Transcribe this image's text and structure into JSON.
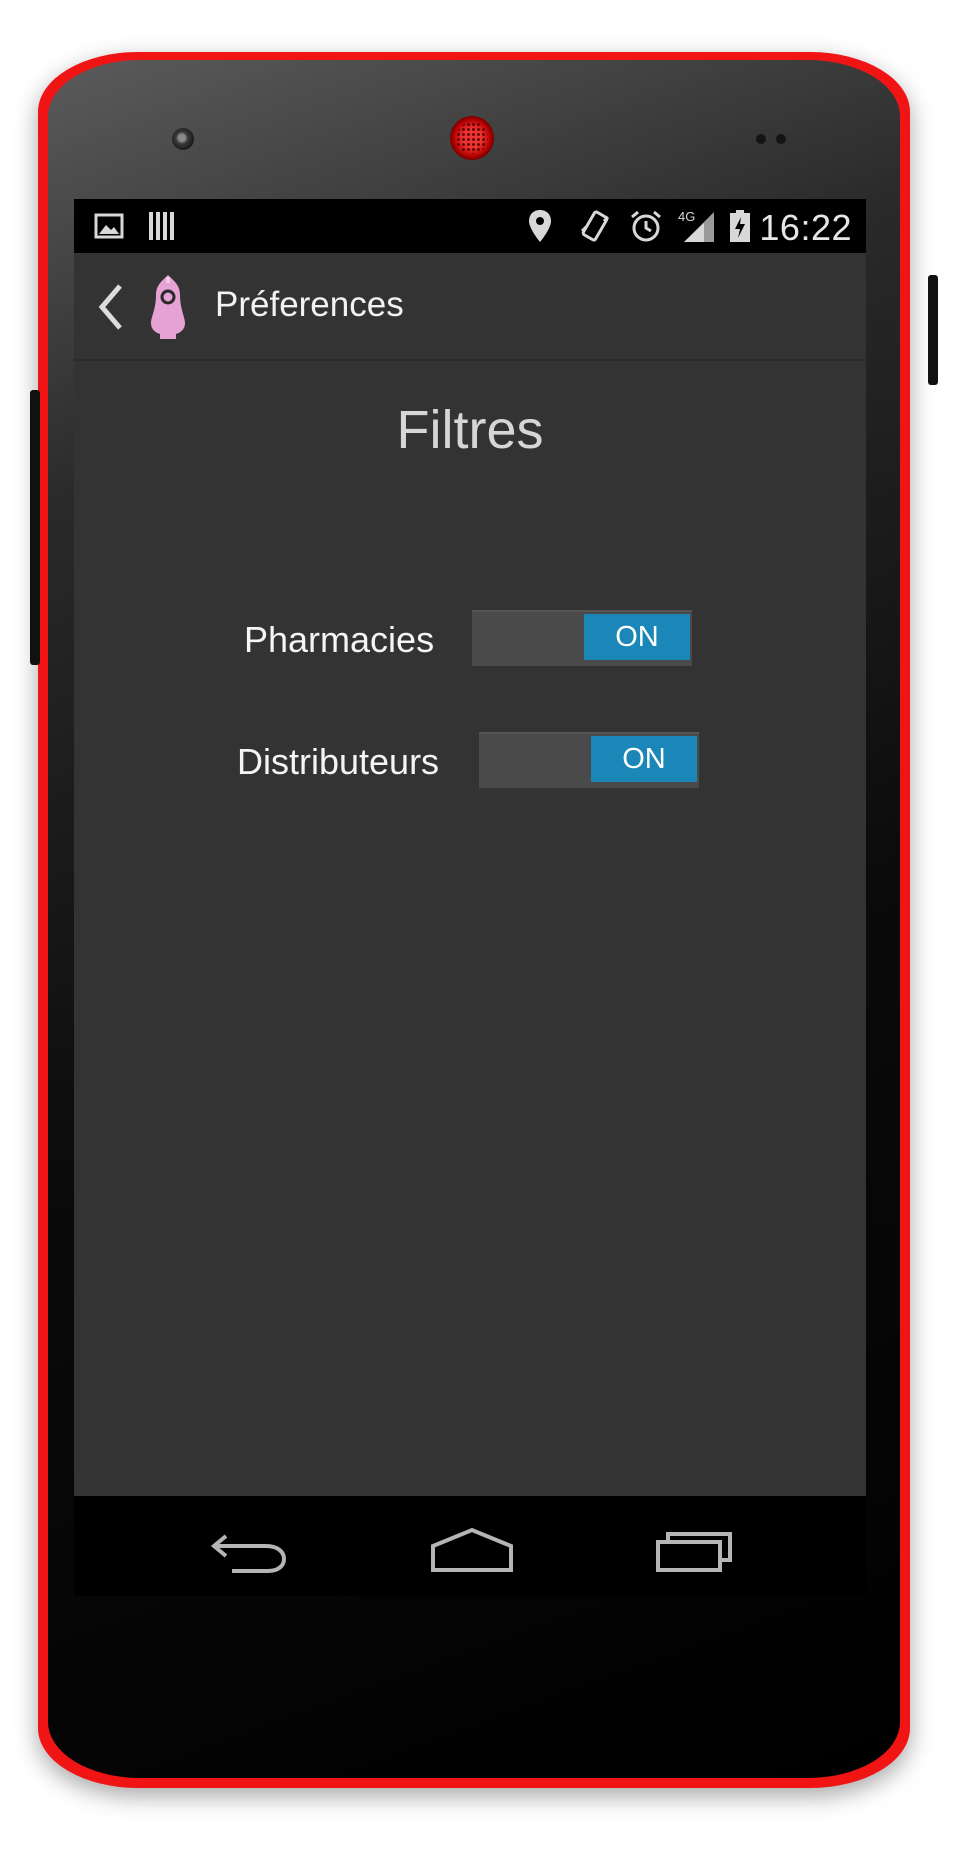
{
  "statusbar": {
    "time": "16:22",
    "network_label": "4G",
    "icons": [
      "gallery-icon",
      "barcode-icon",
      "location-icon",
      "vibrate-icon",
      "alarm-icon",
      "signal-icon",
      "battery-charging-icon"
    ]
  },
  "actionbar": {
    "title": "Préferences",
    "back_icon": "chevron-left-icon",
    "app_icon": "app-logo-icon"
  },
  "main": {
    "heading": "Filtres",
    "filters": [
      {
        "label": "Pharmacies",
        "state": "ON",
        "enabled": true
      },
      {
        "label": "Distributeurs",
        "state": "ON",
        "enabled": true
      }
    ]
  },
  "navbar": {
    "buttons": [
      "back-icon",
      "home-icon",
      "recent-apps-icon"
    ]
  },
  "colors": {
    "frame": "#f01414",
    "screen_background": "#333333",
    "switch_on": "#1a87b8",
    "app_icon": "#e6a2d4"
  }
}
